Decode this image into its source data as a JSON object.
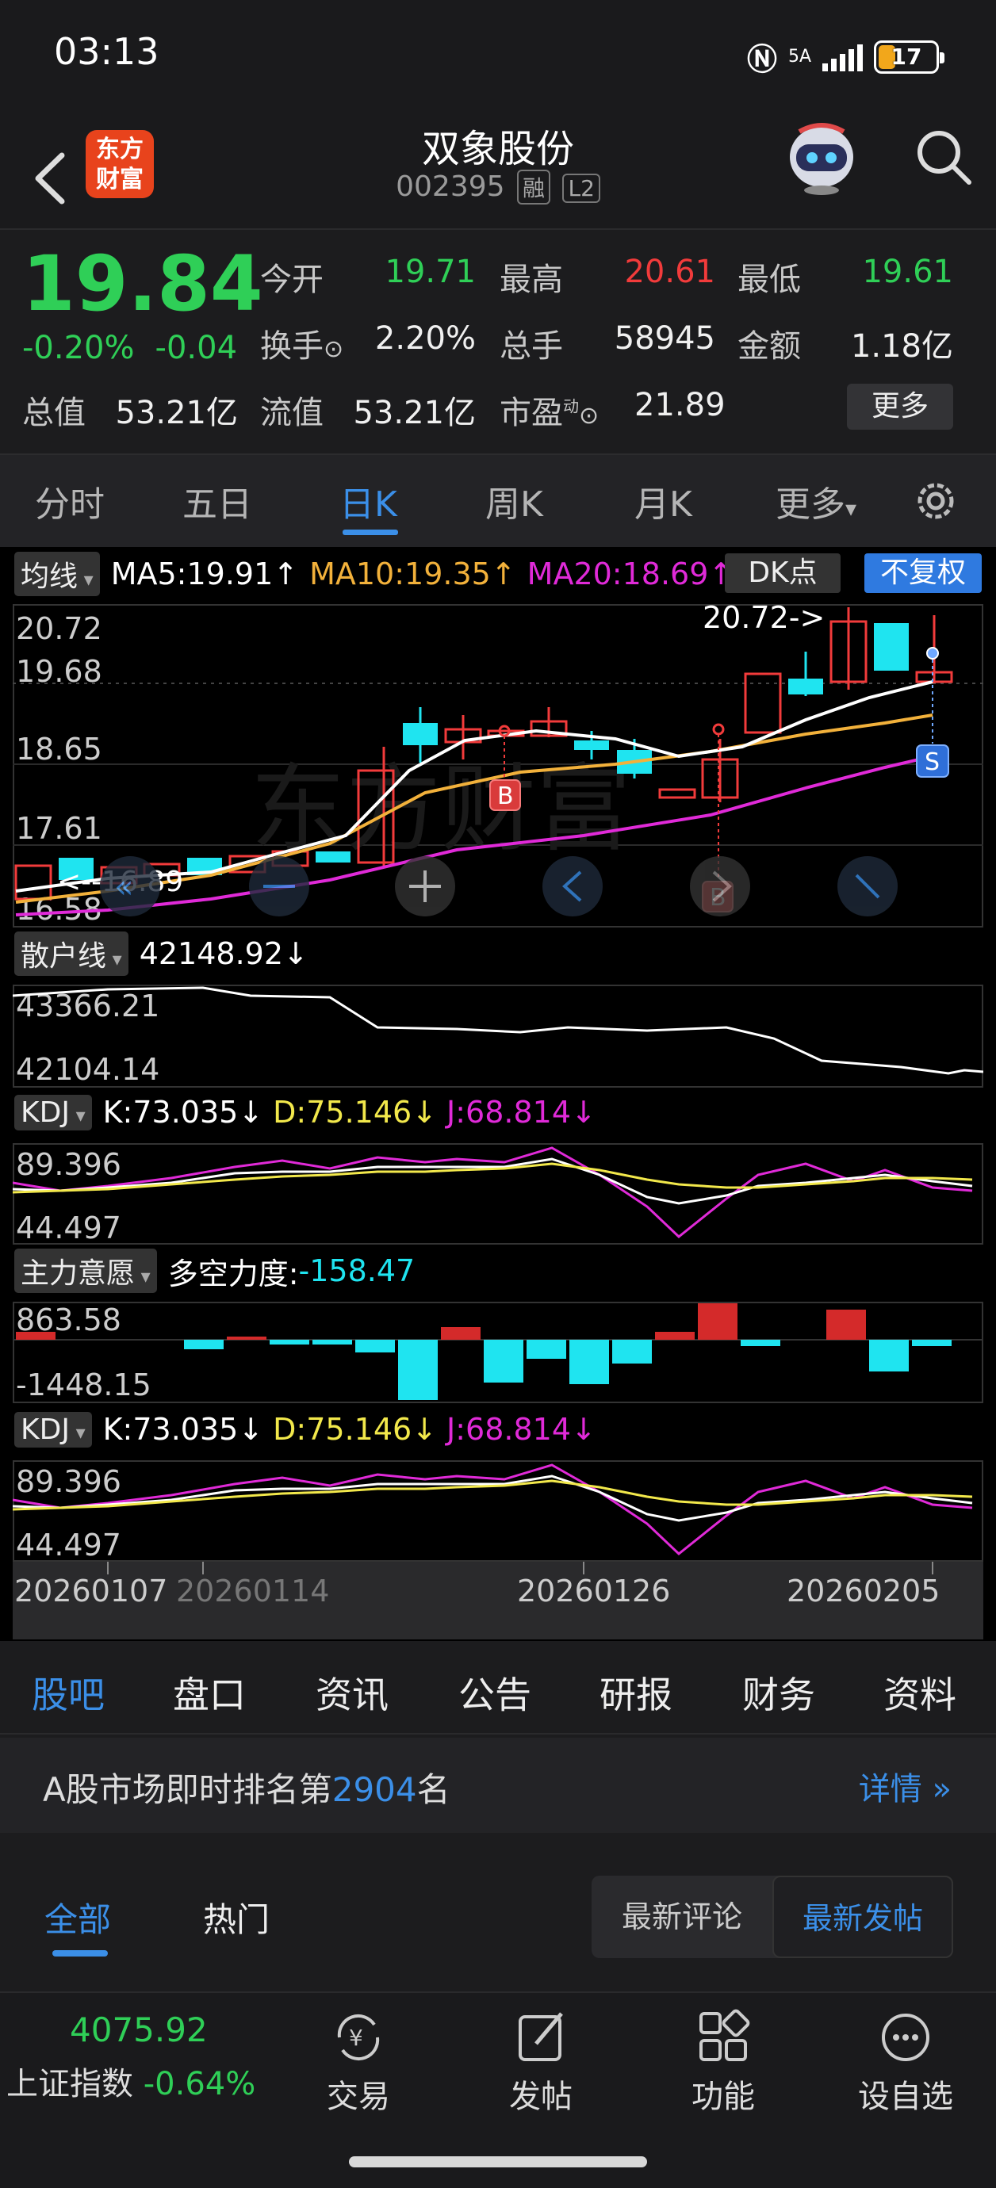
{
  "status": {
    "time": "03:13",
    "network": "5A",
    "battery": "17"
  },
  "header": {
    "logo_line1": "东方",
    "logo_line2": "财富",
    "stock_name": "双象股份",
    "stock_code": "002395",
    "tag_margin": "融",
    "tag_level": "L2"
  },
  "quote": {
    "price": "19.84",
    "change_pct": "-0.20%",
    "change": "-0.04",
    "open_label": "今开",
    "open": "19.71",
    "high_label": "最高",
    "high": "20.61",
    "low_label": "最低",
    "low": "19.61",
    "turnover_label": "换手",
    "turnover": "2.20%",
    "volume_label": "总手",
    "volume": "58945",
    "amount_label": "金额",
    "amount": "1.18亿",
    "mktcap_label": "总值",
    "mktcap": "53.21亿",
    "float_label": "流值",
    "float_cap": "53.21亿",
    "pe_label": "市盈",
    "pe_sup": "动",
    "pe": "21.89",
    "more": "更多"
  },
  "tabs": [
    "分时",
    "五日",
    "日K",
    "周K",
    "月K",
    "更多"
  ],
  "chart": {
    "ma_button": "均线",
    "ma5": "MA5:19.91",
    "ma10": "MA10:19.35",
    "ma20": "MA20:18.69",
    "dk_button": "DK点",
    "adjust_button": "不复权",
    "y_labels": [
      "20.72",
      "19.68",
      "18.65",
      "17.61",
      "16.58"
    ],
    "max_marker": "20.72->",
    "min_marker": "<--16.89",
    "buy_signal": "B",
    "sell_signal": "S",
    "retail_button": "散户线",
    "retail_value": "42148.92",
    "retail_y": [
      "43366.21",
      "42104.14"
    ],
    "kdj_button": "KDJ",
    "k": "K:73.035",
    "d": "D:75.146",
    "j": "J:68.814",
    "kdj_y": [
      "89.396",
      "44.497"
    ],
    "main_button": "主力意愿",
    "force_label": "多空力度:",
    "force_value": "-158.47",
    "main_y": [
      "863.58",
      "-1448.15"
    ],
    "dates": [
      "20260107",
      "20260114",
      "20260126",
      "20260205"
    ],
    "watermark": "东方财富"
  },
  "sub_tabs": [
    "股吧",
    "盘口",
    "资讯",
    "公告",
    "研报",
    "财务",
    "资料"
  ],
  "rank": {
    "prefix": "A股市场即时排名第",
    "value": "2904",
    "suffix": "名",
    "detail": "详情"
  },
  "feed": {
    "all": "全部",
    "hot": "热门",
    "latest_comment": "最新评论",
    "latest_post": "最新发帖"
  },
  "bottom": {
    "index_value": "4075.92",
    "index_name": "上证指数",
    "index_change": "-0.64%",
    "trade": "交易",
    "post": "发帖",
    "function": "功能",
    "watchlist": "设自选"
  },
  "colors": {
    "up": "#f23b3b",
    "down": "#2fcf57",
    "accent": "#3b8fe8",
    "ma10": "#f2b13b",
    "ma20": "#e02ad8",
    "candle_down": "#1fe4f0"
  }
}
